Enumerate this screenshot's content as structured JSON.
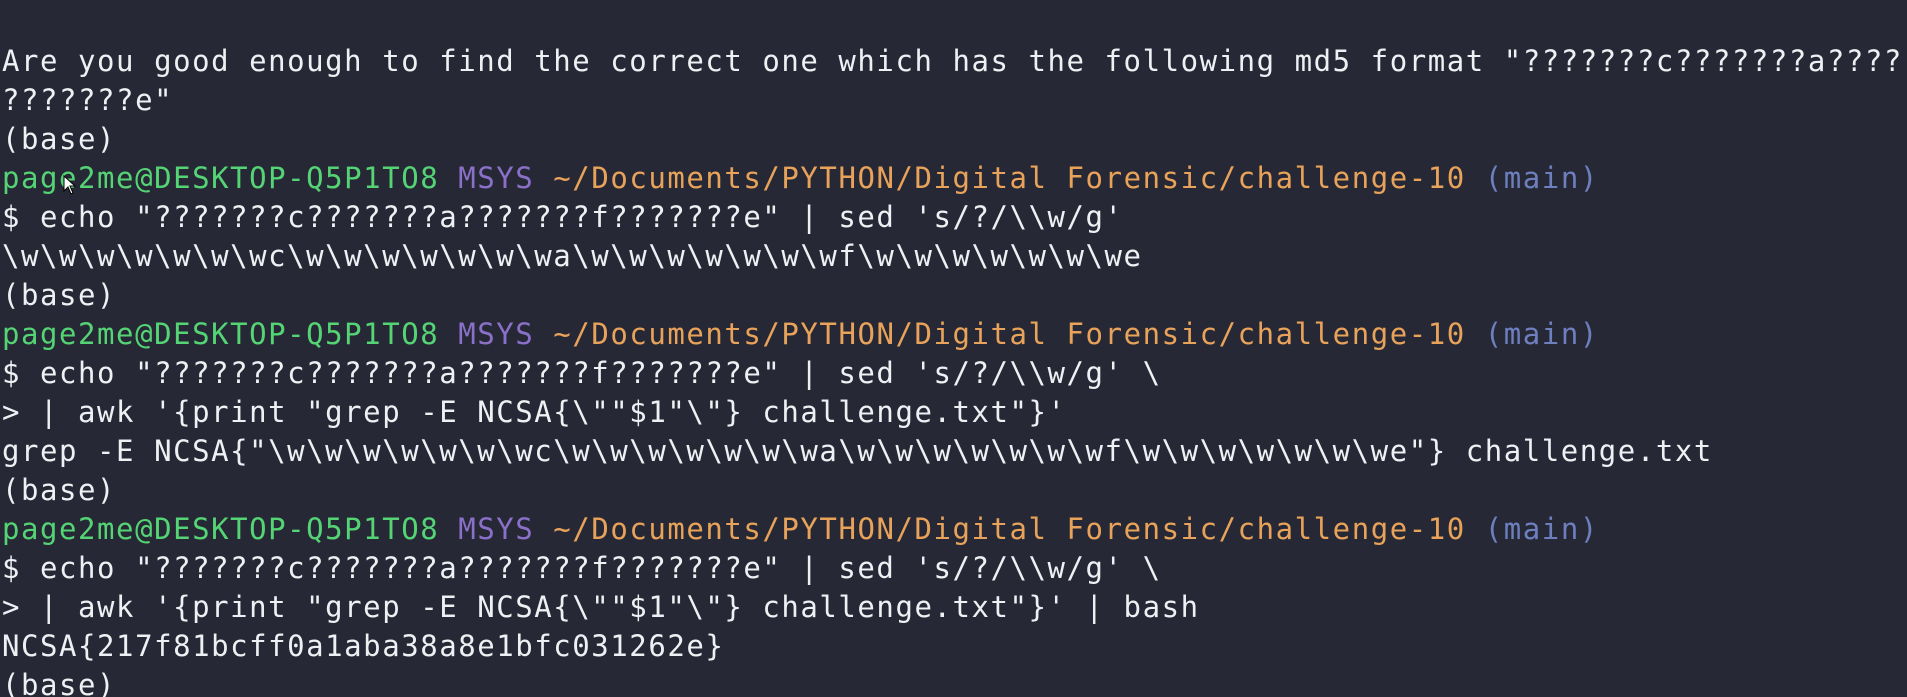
{
  "terminal": {
    "question": {
      "line1": "Are you good enough to find the correct one which has the following md5 format \"???????c???????a???????f",
      "line2": "???????e\""
    },
    "base_label": "(base)",
    "prompt": {
      "user": "page2me@DESKTOP-Q5P1TO8",
      "env": "MSYS",
      "path": "~/Documents/PYTHON/Digital Forensic/challenge-10",
      "branch": "(main)"
    },
    "commands": [
      {
        "input_lines": [
          "$ echo \"???????c???????a???????f???????e\" | sed 's/?/\\\\w/g'"
        ],
        "output": "\\w\\w\\w\\w\\w\\w\\wc\\w\\w\\w\\w\\w\\w\\wa\\w\\w\\w\\w\\w\\w\\wf\\w\\w\\w\\w\\w\\w\\we"
      },
      {
        "input_lines": [
          "$ echo \"???????c???????a???????f???????e\" | sed 's/?/\\\\w/g' \\",
          "> | awk '{print \"grep -E NCSA{\\\"\"$1\"\\\"} challenge.txt\"}'"
        ],
        "output": "grep -E NCSA{\"\\w\\w\\w\\w\\w\\w\\wc\\w\\w\\w\\w\\w\\w\\wa\\w\\w\\w\\w\\w\\w\\wf\\w\\w\\w\\w\\w\\w\\we\"} challenge.txt"
      },
      {
        "input_lines": [
          "$ echo \"???????c???????a???????f???????e\" | sed 's/?/\\\\w/g' \\",
          "> | awk '{print \"grep -E NCSA{\\\"\"$1\"\\\"} challenge.txt\"}' | bash"
        ],
        "output": "NCSA{217f81bcff0a1aba38a8e1bfc031262e}"
      }
    ]
  },
  "colors": {
    "background": "#262935",
    "text": "#eef0f4",
    "user": "#54d474",
    "env": "#8a70c8",
    "path": "#e8a25a",
    "branch": "#6e7fbf"
  }
}
